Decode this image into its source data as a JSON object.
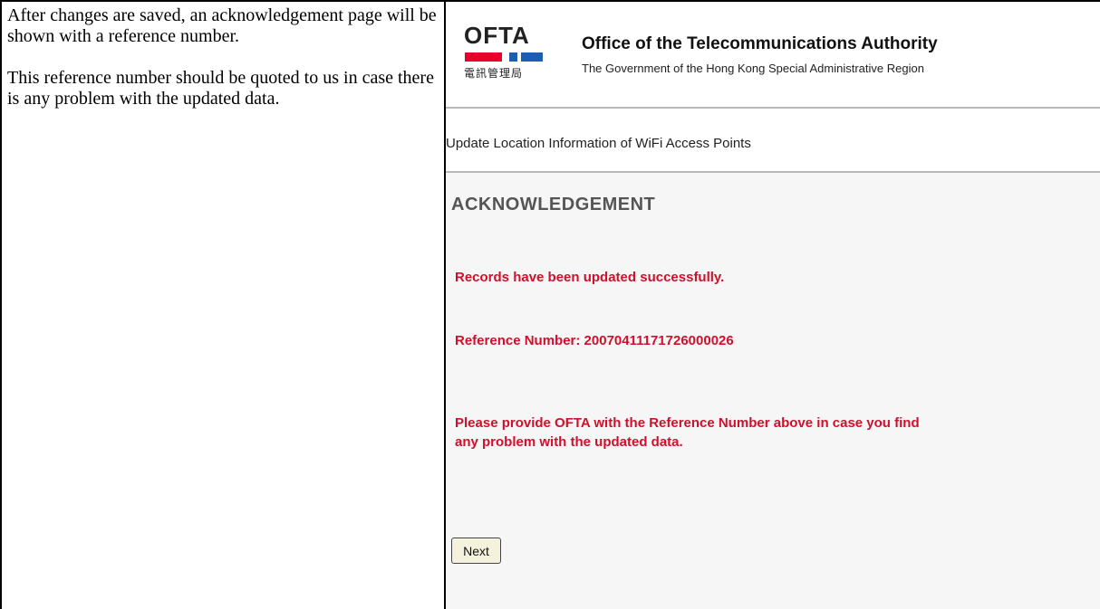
{
  "instructions": {
    "paragraph1": "After changes are saved, an acknowledgement page will be shown with a reference number.",
    "paragraph2": "This reference number should be quoted to us in case there is any problem with the updated data."
  },
  "header": {
    "logo_text": "OFTA",
    "logo_chinese": "電訊管理局",
    "title": "Office of the Telecommunications Authority",
    "subtitle": "The Government of the Hong Kong Special Administrative Region",
    "colors": {
      "red": "#e8002a",
      "blue": "#1b5fb3"
    }
  },
  "breadcrumb": "Update Location Information of WiFi Access Points",
  "page": {
    "heading": "ACKNOWLEDGEMENT",
    "success_message": "Records have been updated successfully.",
    "reference_line": "Reference Number: 20070411171726000026",
    "note": "Please provide OFTA with the Reference Number above in case you find any problem with the updated data.",
    "next_button_label": "Next",
    "message_color": "#d0102b"
  }
}
